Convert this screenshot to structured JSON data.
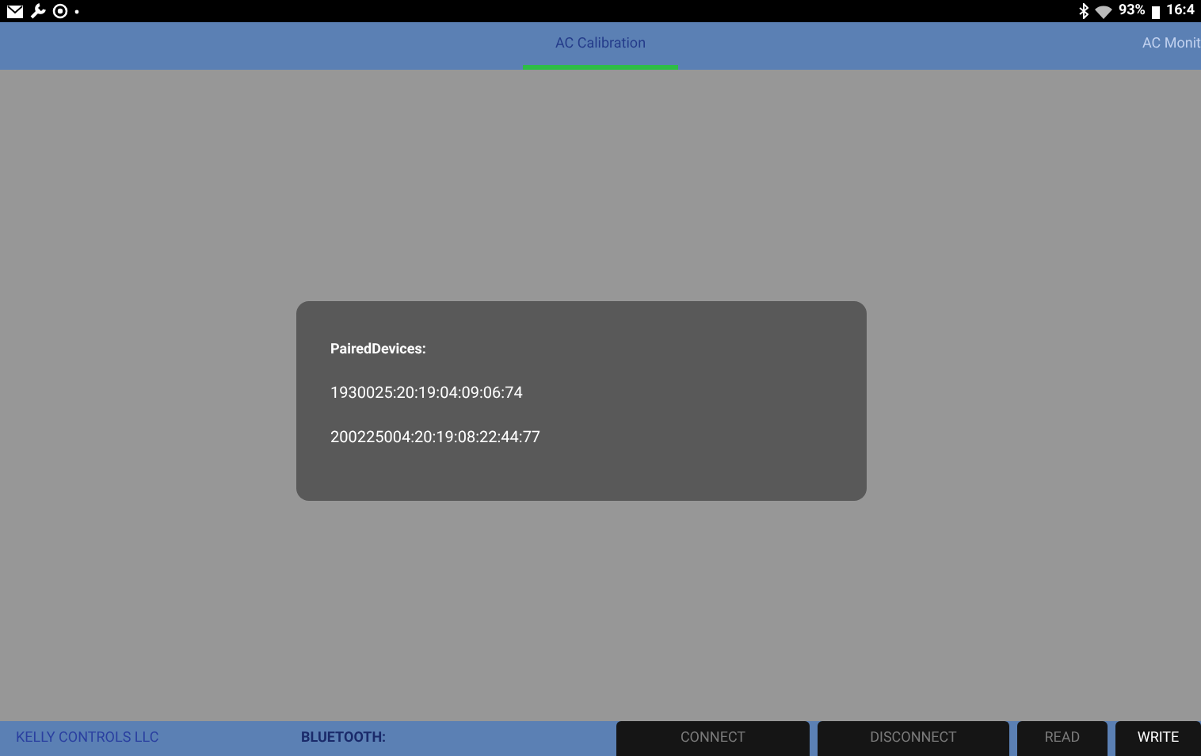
{
  "status_bar": {
    "battery": "93%",
    "time": "16:4"
  },
  "tabs": [
    {
      "label": "AC Calibration",
      "selected": true
    },
    {
      "label": "AC Monit",
      "selected": false
    }
  ],
  "dialog": {
    "title": "PairedDevices:",
    "items": [
      "1930025:20:19:04:09:06:74",
      "200225004:20:19:08:22:44:77"
    ]
  },
  "bottom_bar": {
    "company": "KELLY CONTROLS LLC",
    "bluetooth_label": "BLUETOOTH:",
    "buttons": [
      {
        "label": "CONNECT",
        "disabled": true
      },
      {
        "label": "DISCONNECT",
        "disabled": true
      },
      {
        "label": "READ",
        "disabled": true
      },
      {
        "label": "WRITE",
        "disabled": false
      }
    ]
  }
}
